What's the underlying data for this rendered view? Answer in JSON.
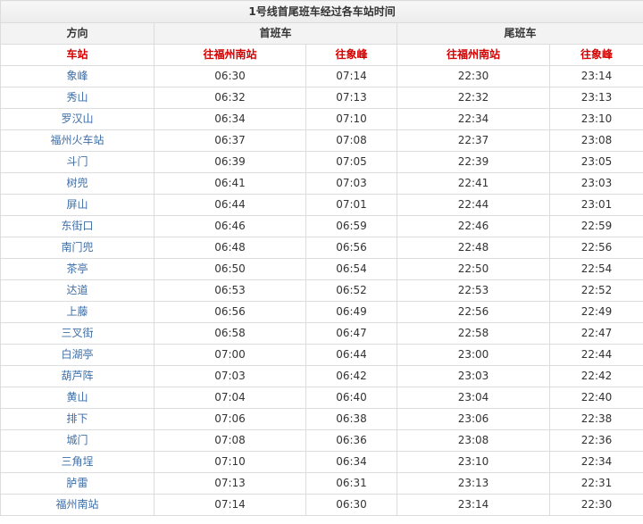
{
  "table": {
    "title": "1号线首尾班车经过各车站时间",
    "direction_header": "方向",
    "first_train_header": "首班车",
    "last_train_header": "尾班车",
    "station_header": "车站",
    "to_fuzhou_south": "往福州南站",
    "to_xiangfeng": "往象峰",
    "station_color": "#3e6ea7",
    "subheader_color": "#d40000",
    "rows": [
      {
        "station": "象峰",
        "first_south": "06:30",
        "first_xiang": "07:14",
        "last_south": "22:30",
        "last_xiang": "23:14"
      },
      {
        "station": "秀山",
        "first_south": "06:32",
        "first_xiang": "07:13",
        "last_south": "22:32",
        "last_xiang": "23:13"
      },
      {
        "station": "罗汉山",
        "first_south": "06:34",
        "first_xiang": "07:10",
        "last_south": "22:34",
        "last_xiang": "23:10"
      },
      {
        "station": "福州火车站",
        "first_south": "06:37",
        "first_xiang": "07:08",
        "last_south": "22:37",
        "last_xiang": "23:08"
      },
      {
        "station": "斗门",
        "first_south": "06:39",
        "first_xiang": "07:05",
        "last_south": "22:39",
        "last_xiang": "23:05"
      },
      {
        "station": "树兜",
        "first_south": "06:41",
        "first_xiang": "07:03",
        "last_south": "22:41",
        "last_xiang": "23:03"
      },
      {
        "station": "屏山",
        "first_south": "06:44",
        "first_xiang": "07:01",
        "last_south": "22:44",
        "last_xiang": "23:01"
      },
      {
        "station": "东街口",
        "first_south": "06:46",
        "first_xiang": "06:59",
        "last_south": "22:46",
        "last_xiang": "22:59"
      },
      {
        "station": "南门兜",
        "first_south": "06:48",
        "first_xiang": "06:56",
        "last_south": "22:48",
        "last_xiang": "22:56"
      },
      {
        "station": "茶亭",
        "first_south": "06:50",
        "first_xiang": "06:54",
        "last_south": "22:50",
        "last_xiang": "22:54"
      },
      {
        "station": "达道",
        "first_south": "06:53",
        "first_xiang": "06:52",
        "last_south": "22:53",
        "last_xiang": "22:52"
      },
      {
        "station": "上藤",
        "first_south": "06:56",
        "first_xiang": "06:49",
        "last_south": "22:56",
        "last_xiang": "22:49"
      },
      {
        "station": "三叉街",
        "first_south": "06:58",
        "first_xiang": "06:47",
        "last_south": "22:58",
        "last_xiang": "22:47"
      },
      {
        "station": "白湖亭",
        "first_south": "07:00",
        "first_xiang": "06:44",
        "last_south": "23:00",
        "last_xiang": "22:44"
      },
      {
        "station": "葫芦阵",
        "first_south": "07:03",
        "first_xiang": "06:42",
        "last_south": "23:03",
        "last_xiang": "22:42"
      },
      {
        "station": "黄山",
        "first_south": "07:04",
        "first_xiang": "06:40",
        "last_south": "23:04",
        "last_xiang": "22:40"
      },
      {
        "station": "排下",
        "first_south": "07:06",
        "first_xiang": "06:38",
        "last_south": "23:06",
        "last_xiang": "22:38"
      },
      {
        "station": "城门",
        "first_south": "07:08",
        "first_xiang": "06:36",
        "last_south": "23:08",
        "last_xiang": "22:36"
      },
      {
        "station": "三角埕",
        "first_south": "07:10",
        "first_xiang": "06:34",
        "last_south": "23:10",
        "last_xiang": "22:34"
      },
      {
        "station": "胪雷",
        "first_south": "07:13",
        "first_xiang": "06:31",
        "last_south": "23:13",
        "last_xiang": "22:31"
      },
      {
        "station": "福州南站",
        "first_south": "07:14",
        "first_xiang": "06:30",
        "last_south": "23:14",
        "last_xiang": "22:30"
      }
    ]
  }
}
